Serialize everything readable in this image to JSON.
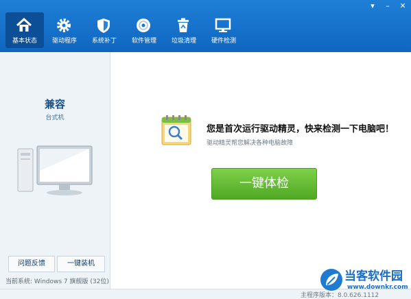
{
  "window": {
    "controls": [
      "▾",
      "–",
      "✕"
    ]
  },
  "toolbar": {
    "tabs": [
      {
        "label": "基本状态",
        "icon": "home-icon",
        "active": true
      },
      {
        "label": "驱动程序",
        "icon": "gear-icon",
        "active": false
      },
      {
        "label": "系统补丁",
        "icon": "shield-icon",
        "active": false
      },
      {
        "label": "软件管理",
        "icon": "disc-icon",
        "active": false
      },
      {
        "label": "垃圾清理",
        "icon": "trash-icon",
        "active": false
      },
      {
        "label": "硬件检测",
        "icon": "monitor-icon",
        "active": false
      }
    ]
  },
  "sidebar": {
    "title": "兼容",
    "subtitle": "台式机",
    "buttons": [
      "问题反馈",
      "一键装机"
    ],
    "system_info": "当前系统:   Windows 7 旗舰版 (32位)"
  },
  "main": {
    "headline": "您是首次运行驱动精灵，快来检测一下电脑吧！",
    "subline": "驱动精灵帮您解决各种电脑故障",
    "scan_button": "一键体检"
  },
  "status": {
    "version": "主程序版本：8.0.626.1112"
  },
  "watermark": {
    "name": "当客软件园",
    "url": "www.downkr.com"
  },
  "colors": {
    "toolbar": "#1577cf",
    "accent_green": "#5bb52d",
    "sidebar_bg": "#eef3f8"
  }
}
